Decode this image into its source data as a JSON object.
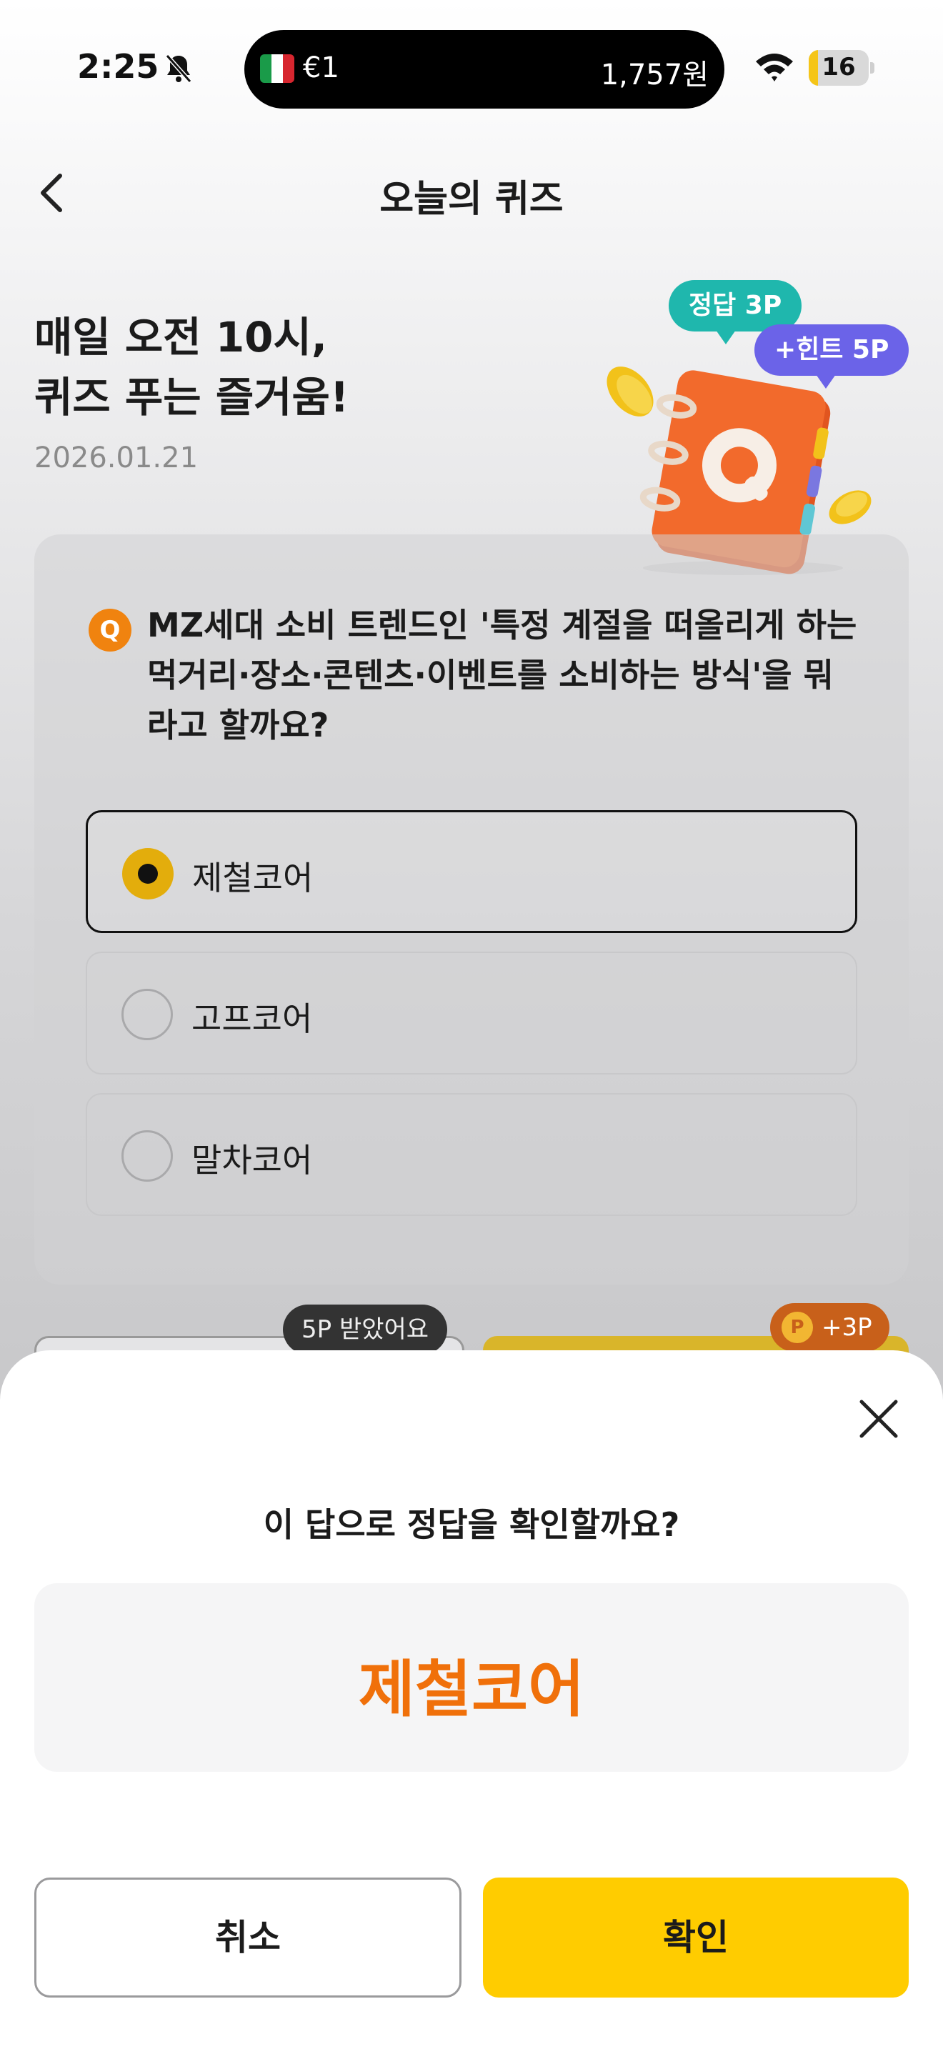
{
  "status_bar": {
    "time": "2:25",
    "island_left": "€1",
    "island_right": "1,757원",
    "battery_level": "16",
    "battery_fraction": 0.16,
    "icons": [
      "bell-slash-icon",
      "italy-flag-icon",
      "wifi-icon",
      "battery-icon"
    ]
  },
  "header": {
    "title": "오늘의 퀴즈",
    "back_icon": "chevron-left-icon"
  },
  "hero": {
    "headline_line1": "매일 오전 10시,",
    "headline_line2": "퀴즈 푸는 즐거움!",
    "date": "2026.01.21",
    "tag_answer": "정답 3P",
    "tag_hint": "+힌트 5P"
  },
  "quiz": {
    "badge": "Q",
    "question": "MZ세대 소비 트렌드인 '특정 계절을 떠올리게 하는 먹거리·장소·콘텐츠·이벤트를 소비하는 방식'을 뭐라고 할까요?",
    "options": [
      {
        "label": "제철코어",
        "selected": true
      },
      {
        "label": "고프코어",
        "selected": false
      },
      {
        "label": "말차코어",
        "selected": false
      }
    ]
  },
  "behind": {
    "hint_pill": "5P 받았어요",
    "reward_coin": "P",
    "reward_pill": "+3P"
  },
  "sheet": {
    "question": "이 답으로 정답을 확인할까요?",
    "answer": "제철코어",
    "cancel_label": "취소",
    "confirm_label": "확인"
  },
  "colors": {
    "accent_yellow": "#ffcc00",
    "answer_orange": "#f0700a",
    "tag_teal": "#1fb7ad",
    "tag_purple": "#6b63e8",
    "badge_orange": "#f0830f"
  }
}
